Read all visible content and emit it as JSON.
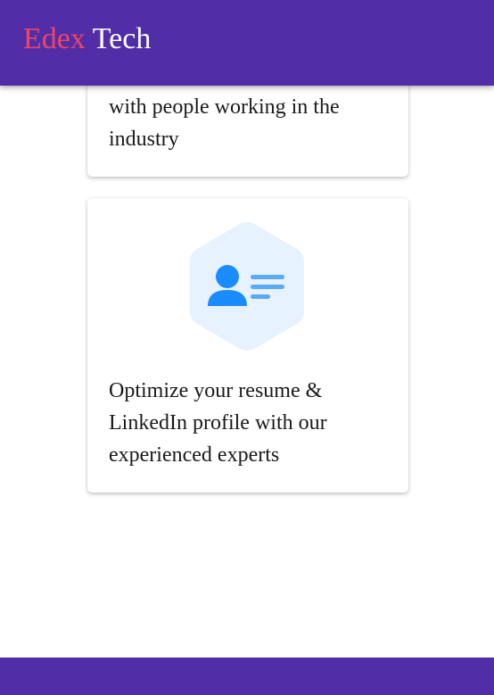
{
  "header": {
    "brand_first": "Edex",
    "brand_second": "Tech"
  },
  "cards": [
    {
      "text_lines": [
        "with people working in the",
        "industry"
      ]
    },
    {
      "icon": "profile-card-icon",
      "text_lines": [
        "Optimize your resume &",
        "LinkedIn profile with our",
        "experienced experts"
      ]
    }
  ],
  "colors": {
    "header_bg": "#512da8",
    "brand_accent": "#ef4565",
    "icon_blue": "#1a8cff",
    "icon_bg": "#e6f2ff"
  }
}
